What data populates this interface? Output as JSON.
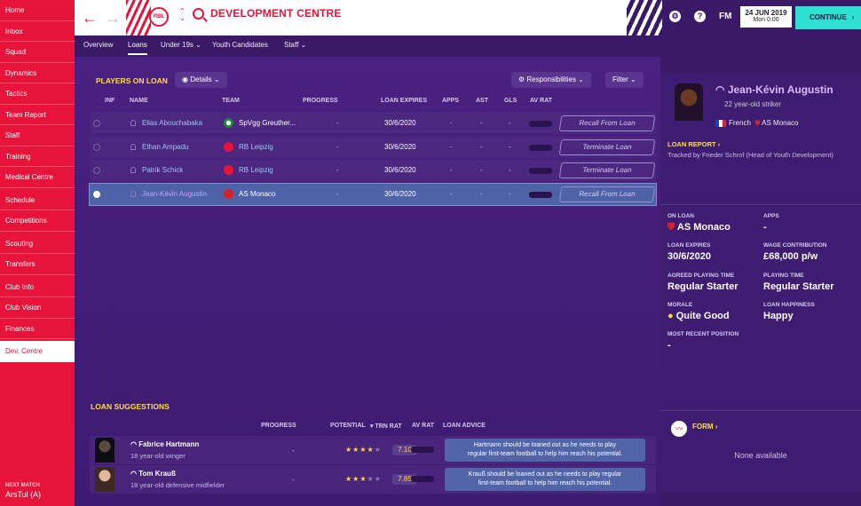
{
  "sidebar": {
    "items": [
      "Home",
      "Inbox",
      "Squad",
      "Dynamics",
      "Tactics",
      "Team Report",
      "Staff",
      "Training",
      "Medical Centre",
      "Schedule",
      "Competitions",
      "Scouting",
      "Transfers",
      "Club Info",
      "Club Vision",
      "Finances",
      "Dev. Centre"
    ],
    "active": "Dev. Centre",
    "next_match_label": "NEXT MATCH",
    "next_match_value": "ArsTul (A)"
  },
  "header": {
    "title": "DEVELOPMENT CENTRE",
    "club_logo_text": "RBL",
    "help_icon": "?",
    "fm_logo": "FM",
    "date": "24 JUN 2019",
    "time": "Mon 0:00",
    "continue_label": "CONTINUE"
  },
  "tabs": [
    "Overview",
    "Loans",
    "Under 19s",
    "Youth Candidates",
    "Staff"
  ],
  "active_tab": "Loans",
  "loans": {
    "title": "PLAYERS ON LOAN",
    "details_label": "Details",
    "responsibilities_label": "Responsibilities",
    "filter_label": "Filter",
    "columns": [
      "INF",
      "NAME",
      "TEAM",
      "PROGRESS",
      "LOAN EXPIRES",
      "APPS",
      "AST",
      "GLS",
      "AV RAT"
    ],
    "rows": [
      {
        "name": "Elias Abouchabaka",
        "team": "SpVgg Greuther...",
        "team_color": "#1a8a3a",
        "progress": "-",
        "expires": "30/6/2020",
        "apps": "-",
        "ast": "-",
        "gls": "-",
        "action": "Recall From Loan"
      },
      {
        "name": "Ethan Ampadu",
        "team": "RB Leipzig",
        "team_color": "#e8133a",
        "progress": "-",
        "expires": "30/6/2020",
        "apps": "-",
        "ast": "-",
        "gls": "-",
        "action": "Terminate Loan"
      },
      {
        "name": "Patrik Schick",
        "team": "RB Leipzig",
        "team_color": "#e8133a",
        "progress": "-",
        "expires": "30/6/2020",
        "apps": "-",
        "ast": "-",
        "gls": "-",
        "action": "Terminate Loan"
      },
      {
        "name": "Jean-Kévin Augustin",
        "team": "AS Monaco",
        "team_color": "#d8202a",
        "progress": "-",
        "expires": "30/6/2020",
        "apps": "-",
        "ast": "-",
        "gls": "-",
        "action": "Recall From Loan"
      }
    ]
  },
  "suggestions": {
    "title": "LOAN SUGGESTIONS",
    "columns": [
      "PROGRESS",
      "POTENTIAL",
      "TRN RAT",
      "AV RAT",
      "LOAN ADVICE"
    ],
    "rows": [
      {
        "name": "Fabrice Hartmann",
        "sub": "18 year-old winger",
        "progress": "-",
        "stars_on": 3.5,
        "trn": "7.10",
        "advice_1": "Hartmann should be loaned out as he needs to play",
        "advice_2": "regular first-team football to help him reach his potential."
      },
      {
        "name": "Tom Krauß",
        "sub": "18 year-old defensive midfielder",
        "progress": "-",
        "stars_on": 3,
        "trn": "7.85",
        "advice_1": "Krauß should be loaned out as he needs to play regular",
        "advice_2": "first-team football to help him reach his potential."
      }
    ]
  },
  "profile": {
    "name": "Jean-Kévin Augustin",
    "age": "22 year-old striker",
    "nationality": "French",
    "club": "AS Monaco",
    "loan_report_label": "LOAN REPORT",
    "tracked": "Tracked by Frieder Schrof (Head of Youth Development)",
    "on_loan_label": "ON LOAN",
    "on_loan": "AS Monaco",
    "apps_label": "APPS",
    "apps": "-",
    "loan_expires_label": "LOAN EXPIRES",
    "loan_expires": "30/6/2020",
    "wage_label": "WAGE CONTRIBUTION",
    "wage": "£68,000 p/w",
    "agreed_label": "AGREED PLAYING TIME",
    "agreed": "Regular Starter",
    "playing_label": "PLAYING TIME",
    "playing": "Regular Starter",
    "morale_label": "MORALE",
    "morale": "Quite Good",
    "happiness_label": "LOAN HAPPINESS",
    "happiness": "Happy",
    "recent_pos_label": "MOST RECENT POSITION",
    "recent_pos": "-",
    "form_label": "FORM",
    "form_none": "None available"
  }
}
